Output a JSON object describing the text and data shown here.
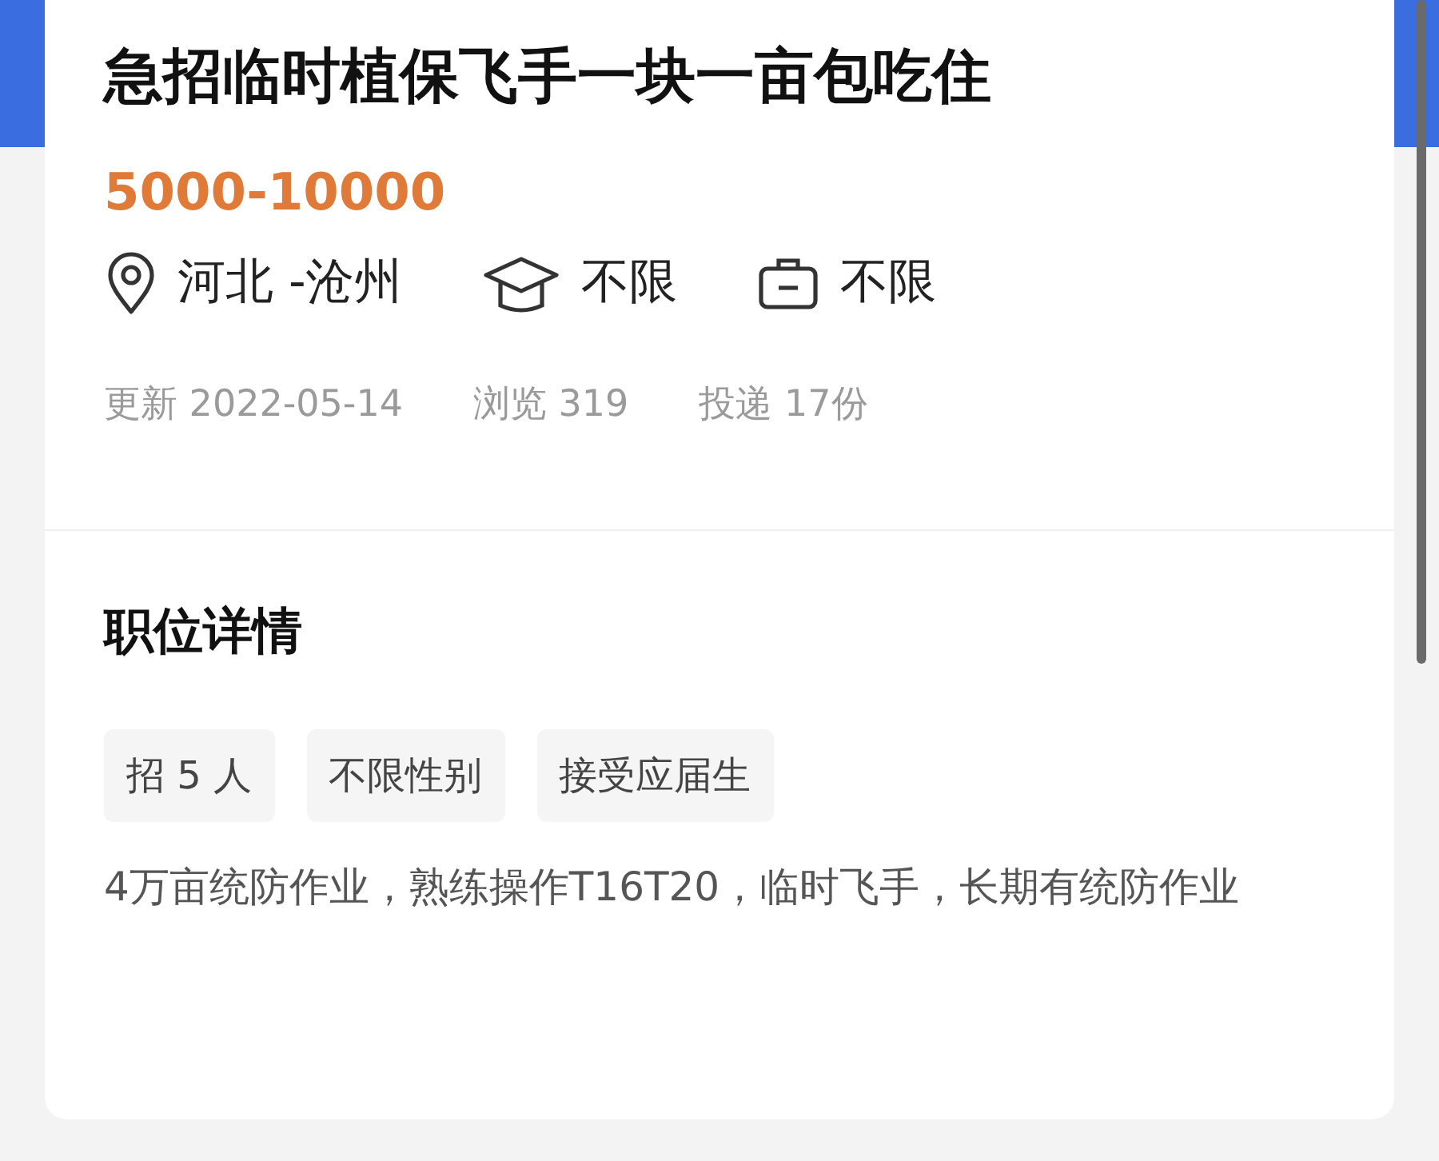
{
  "job": {
    "title": "急招临时植保飞手一块一亩包吃住",
    "salary": "5000-10000",
    "requirements": [
      {
        "kind": "location",
        "text": "河北 -沧州"
      },
      {
        "kind": "education",
        "text": "不限"
      },
      {
        "kind": "experience",
        "text": "不限"
      }
    ],
    "stats": [
      "更新 2022-05-14",
      "浏览 319",
      "投递 17份"
    ]
  },
  "details": {
    "heading": "职位详情",
    "tags": [
      "招 5 人",
      "不限性别",
      "接受应届生"
    ],
    "description": "4万亩统防作业，熟练操作T16T20，临时飞手，长期有统防作业"
  }
}
